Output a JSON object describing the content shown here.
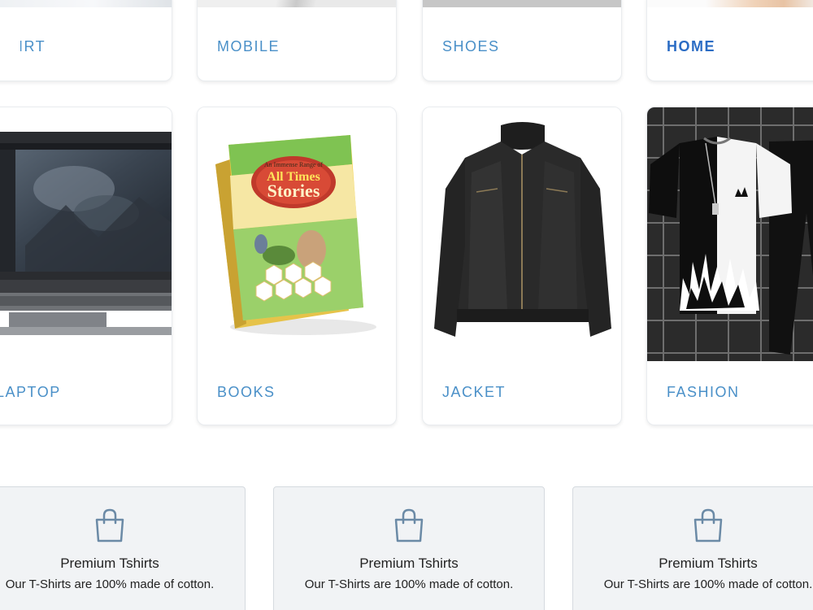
{
  "top_row": [
    {
      "label": "SHIRT"
    },
    {
      "label": "MOBILE"
    },
    {
      "label": "SHOES"
    },
    {
      "label": "HOME"
    }
  ],
  "categories": [
    {
      "label": "LAPTOP"
    },
    {
      "label": "BOOKS",
      "book_text": {
        "small": "An Immense Range of",
        "big1": "All Times",
        "big2": "Stories"
      }
    },
    {
      "label": "JACKET"
    },
    {
      "label": "FASHION"
    }
  ],
  "features": [
    {
      "icon": "shopping-bag-icon",
      "title": "Premium Tshirts",
      "desc": "Our T-Shirts are 100% made of cotton."
    },
    {
      "icon": "shopping-bag-icon",
      "title": "Premium Tshirts",
      "desc": "Our T-Shirts are 100% made of cotton."
    },
    {
      "icon": "shopping-bag-icon",
      "title": "Premium Tshirts",
      "desc": "Our T-Shirts are 100% made of cotton."
    }
  ],
  "colors": {
    "label": "#4a90c8",
    "label_active": "#2b6cc4",
    "feature_bg": "#f1f3f5",
    "icon_stroke": "#6b8aa6"
  }
}
